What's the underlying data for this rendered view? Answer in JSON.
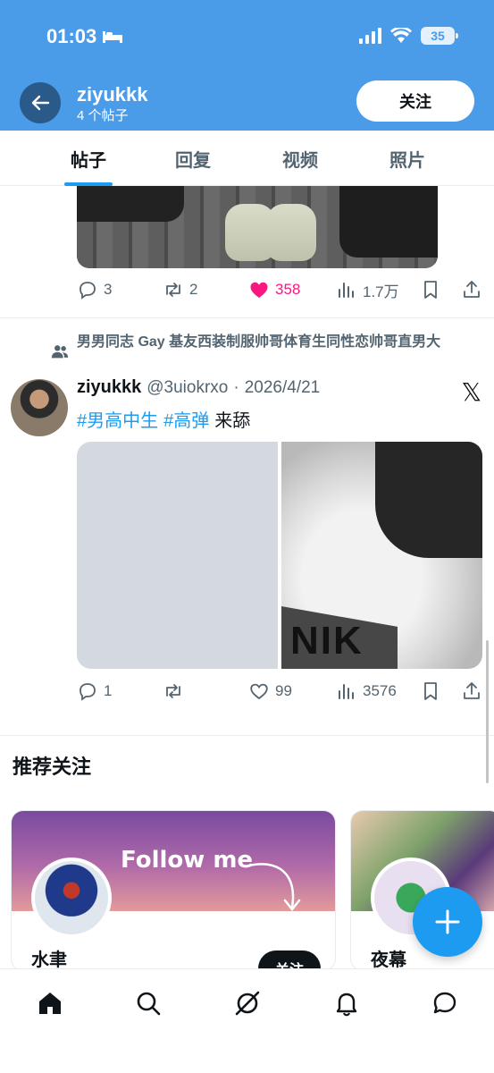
{
  "status_bar": {
    "time": "01:03",
    "battery": "35"
  },
  "header": {
    "name": "ziyukkk",
    "post_count": "4 个帖子",
    "follow_label": "关注"
  },
  "tabs": [
    {
      "label": "帖子"
    },
    {
      "label": "回复"
    },
    {
      "label": "视频"
    },
    {
      "label": "照片"
    }
  ],
  "post1": {
    "replies": "3",
    "retweets": "2",
    "likes": "358",
    "views": "1.7万"
  },
  "post2": {
    "community": "男男同志 Gay 基友西装制服帅哥体育生同性恋帅哥直男大",
    "author": "ziyukkk",
    "handle": "@3uiokrxo",
    "sep": "·",
    "date": "2026/4/21",
    "hashtag1": "#男高中生",
    "hashtag2": "#高弹",
    "text": "来舔",
    "media_overlay_text": "NIK",
    "replies": "1",
    "retweets": "",
    "likes": "99",
    "views": "3576"
  },
  "recommend": {
    "title": "推荐关注",
    "cards": [
      {
        "banner_text": "Follow me",
        "name": "水聿",
        "follow_label": "关注"
      },
      {
        "name": "夜幕"
      }
    ]
  },
  "colors": {
    "accent": "#1d9bf0",
    "header_bg": "#4a9be8",
    "like_pink": "#f91880",
    "text_secondary": "#536471"
  },
  "icons": [
    "back-arrow-icon",
    "reply-icon",
    "retweet-icon",
    "heart-icon",
    "views-icon",
    "bookmark-icon",
    "share-icon",
    "community-icon",
    "x-logo-icon",
    "home-icon",
    "search-icon",
    "grok-icon",
    "bell-icon",
    "messages-icon",
    "plus-icon"
  ]
}
